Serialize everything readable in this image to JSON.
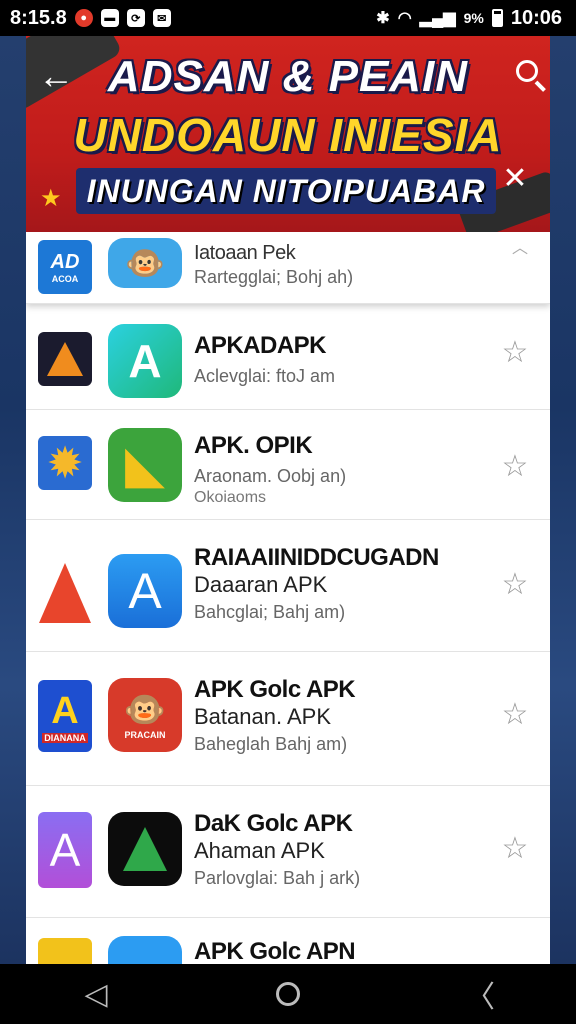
{
  "status": {
    "time_left": "8:15.8",
    "signal_text": "9%",
    "clock": "10:06"
  },
  "banner": {
    "line1": "ADSAN & PEAIN",
    "line2": "UNDOAUN INIESIA",
    "line3": "INUNGAN NITOIPUABAR"
  },
  "apps": [
    {
      "logo_text": "AD\nACOA",
      "name": "Iatoaan Pek",
      "line2": "",
      "sub": "Rartegglai; Bohj ah)",
      "sub2": ""
    },
    {
      "logo_text": "",
      "name": "APKADAPK",
      "line2": "",
      "sub": "Aclevglai: ftoJ am",
      "sub2": ""
    },
    {
      "logo_text": "",
      "name": "APK. OPIK",
      "line2": "",
      "sub": "Araonam. Oobj an)",
      "sub2": "Okoiaoms"
    },
    {
      "logo_text": "",
      "name": "RAIAAIINIDDCUGADN",
      "line2": "Daaaran APK",
      "sub": "Bahcglai; Bahj am)",
      "sub2": ""
    },
    {
      "logo_text": "PRACAIN",
      "name": "APK Golc APK",
      "line2": "Batanan. APK",
      "sub": "Baheglah Bahj am)",
      "sub2": ""
    },
    {
      "logo_text": "",
      "name": "DaK Golc APK",
      "line2": "Ahaman APK",
      "sub": "Parlovglai: Bah j ark)",
      "sub2": ""
    },
    {
      "logo_text": "",
      "name": "APK Golc APN",
      "line2": "",
      "sub": "",
      "sub2": ""
    }
  ],
  "nav": {
    "back": "◁",
    "recent": "〈"
  }
}
